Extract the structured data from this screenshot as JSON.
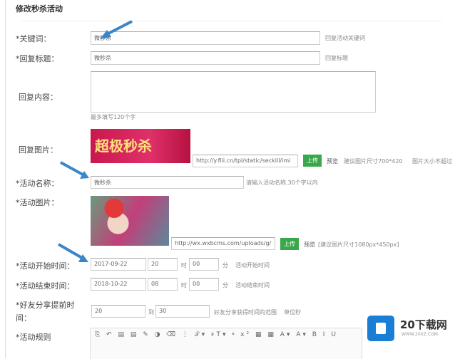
{
  "page_title": "修改秒杀活动",
  "fields": {
    "keyword": {
      "label": "*关键词：",
      "value": "微秒杀",
      "hint": "回复活动关键词"
    },
    "reply_title": {
      "label": "*回复标题：",
      "value": "微秒杀",
      "hint": "回复标题"
    },
    "reply_content": {
      "label": "回复内容：",
      "value": "",
      "hint": "最多填写120个字"
    },
    "reply_image": {
      "label": "回复图片：",
      "banner_text": "超极秒杀",
      "url": "http://y.fiii.cn/tpl/static/seckill/imi",
      "upload": "上传",
      "preview": "预览",
      "hint1": "建议图片尺寸700*420",
      "hint2": "图片大小不超过"
    },
    "activity_name": {
      "label": "*活动名称：",
      "value": "微秒杀",
      "hint": "请输入活动名称,30个字以内"
    },
    "activity_image": {
      "label": "*活动图片：",
      "url": "http://wx.wxbcms.com/uploads/g/",
      "upload": "上传",
      "preview": "预览",
      "hint": "[建议图片尺寸1080px*450px]"
    },
    "start_time": {
      "label": "*活动开始时间：",
      "date": "2017-09-22",
      "hour": "20",
      "hour_unit": "时",
      "minute": "00",
      "minute_unit": "分",
      "hint": "活动开始时间"
    },
    "end_time": {
      "label": "*活动结束时间：",
      "date": "2018-10-22",
      "hour": "08",
      "hour_unit": "时",
      "minute": "00",
      "minute_unit": "分",
      "hint": "活动结束时间"
    },
    "share_time": {
      "label1": "*好友分享提前时",
      "label2": "间：",
      "from": "20",
      "to_label": "到",
      "to": "30",
      "hint": "好友分享获得时间的范围",
      "unit": "单位秒"
    },
    "rules": {
      "label": "*活动规则",
      "toolbar": "⎘ ↶ ▤ ▤ ✎ ◑ ⌫ ⋮ 𝒯▾ ꜰT▾ ײ x² ▦ ▦ A▾ A▾ B I U"
    }
  },
  "watermark": {
    "name": "20下载网",
    "url": "WWW.20XZ.COM"
  },
  "colors": {
    "upload_button": "#3aa84a",
    "arrow": "#3a86c8",
    "logo": "#1a7fd4"
  }
}
